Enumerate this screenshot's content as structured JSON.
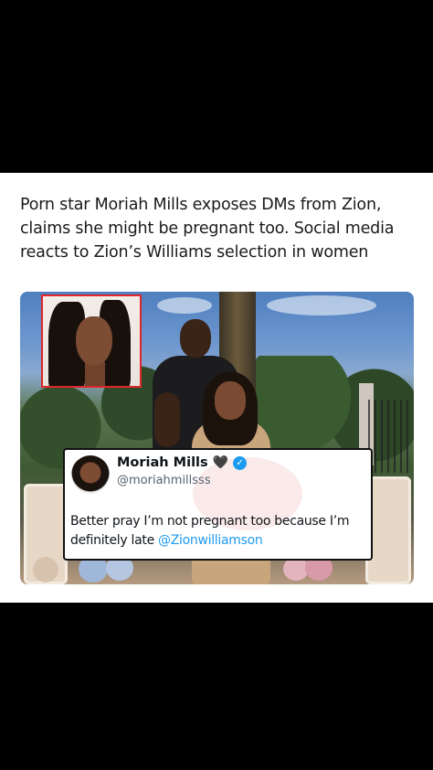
{
  "post": {
    "headline": "Porn star Moriah Mills exposes DMs from Zion, claims she might be pregnant too. Social media reacts to Zion’s Williams selection in women"
  },
  "tweet": {
    "name": "Moriah Mills",
    "name_emoji": "🖤",
    "handle": "@moriahmillsss",
    "text_before": "Better pray I’m not pregnant too because I’m definitely late ",
    "mention": "@Zionwilliamson",
    "verified_icon": "verified-badge-icon"
  },
  "colors": {
    "background": "#000000",
    "card": "#ffffff",
    "inset_border": "#e0262a",
    "mention": "#1d9bf0",
    "verified": "#1d9bf0"
  }
}
